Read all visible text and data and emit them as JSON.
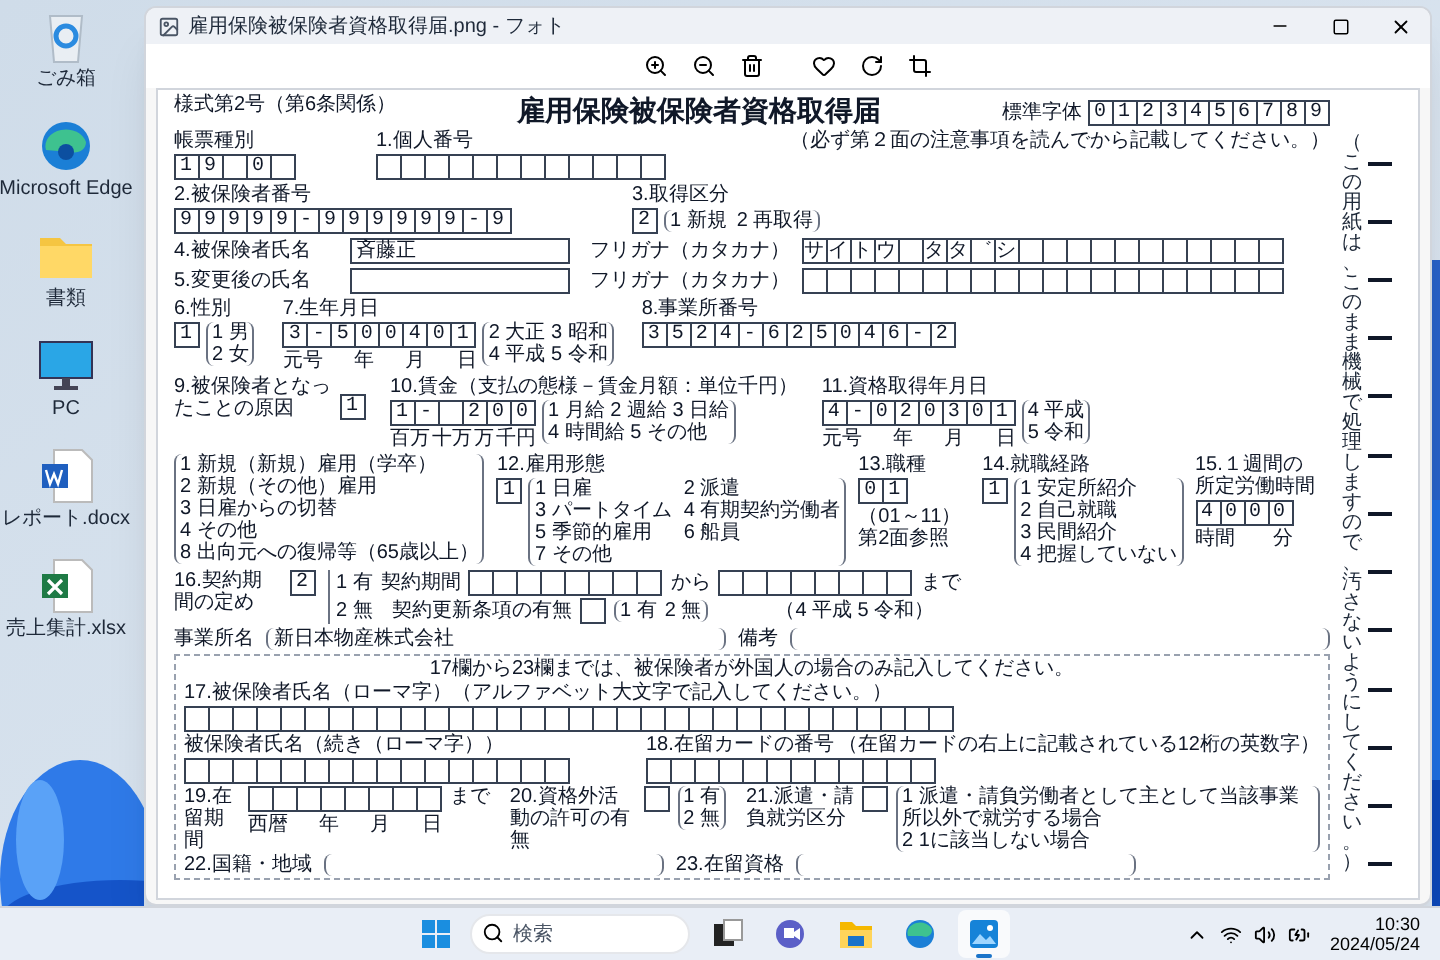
{
  "desktop_icons": [
    {
      "label": "ごみ箱",
      "kind": "recycle"
    },
    {
      "label": "Microsoft Edge",
      "kind": "edge"
    },
    {
      "label": "書類",
      "kind": "folder"
    },
    {
      "label": "PC",
      "kind": "pc"
    },
    {
      "label": "レポート.docx",
      "kind": "word"
    },
    {
      "label": "売上集計.xlsx",
      "kind": "excel"
    }
  ],
  "window": {
    "title": "雇用保険被保険者資格取得届.png - フォト"
  },
  "form": {
    "form_number": "様式第2号（第6条関係）",
    "title": "雇用保険被保険者資格取得届",
    "glyph_sample": {
      "label": "標準字体",
      "digits": "0123456789"
    },
    "note": "（必ず第２面の注意事項を読んでから記載してください。）",
    "slip_type": {
      "label": "帳票種別",
      "value": "19 0"
    },
    "individual_number": {
      "label": "1.個人番号"
    },
    "insured_number": {
      "label": "2.被保険者番号",
      "value": "99999-999999-9"
    },
    "acquisition_type": {
      "label": "3.取得区分",
      "value": "2",
      "options": [
        "1 新規",
        "2 再取得"
      ]
    },
    "name": {
      "label": "4.被保険者氏名",
      "value": "斉藤正",
      "kana_label": "フリガナ（カタカナ）",
      "kana": "サイトウ　タタ゛シ"
    },
    "new_name": {
      "label": "5.変更後の氏名",
      "kana_label": "フリガナ（カタカナ）"
    },
    "sex": {
      "label": "6.性別",
      "value": "1",
      "options": [
        "1 男",
        "2 女"
      ]
    },
    "birth_date": {
      "label": "7.生年月日",
      "value": "3-500401",
      "units": [
        "元号",
        "年",
        "月",
        "日"
      ],
      "options": [
        "2 大正 3 昭和",
        "4 平成 5 令和"
      ]
    },
    "office_number": {
      "label": "8.事業所番号",
      "value": "3524-625046-2"
    },
    "cause": {
      "label": "9.被保険者となったことの原因",
      "value": "1",
      "options": [
        "1 新規（新規）雇用（学卒）",
        "2 新規（その他）雇用",
        "3 日雇からの切替",
        "4 その他",
        "8 出向元への復帰等（65歳以上）"
      ]
    },
    "wage": {
      "label": "10.賃金（支払の態様－賃金月額：単位千円）",
      "value": "1- 200",
      "units": [
        "百万",
        "十万",
        "万",
        "千円"
      ],
      "options": [
        "1 月給 2 週給 3 日給",
        "4 時間給 5 その他"
      ]
    },
    "acquisition_date": {
      "label": "11.資格取得年月日",
      "value": "4-020301",
      "units": [
        "元号",
        "年",
        "月",
        "日"
      ],
      "options": [
        "4 平成",
        "5 令和"
      ]
    },
    "employment_type": {
      "label": "12.雇用形態",
      "value": "1",
      "options": [
        "1 日雇",
        "2 派遣",
        "3 パートタイム",
        "4 有期契約労働者",
        "5 季節的雇用",
        "6 船員",
        "7 その他"
      ]
    },
    "occupation": {
      "label": "13.職種",
      "value": "01",
      "note": "（01～11）第2面参照"
    },
    "job_route": {
      "label": "14.就職経路",
      "value": "1",
      "options": [
        "1 安定所紹介",
        "2 自己就職",
        "3 民間紹介",
        "4 把握していない"
      ]
    },
    "weekly_hours": {
      "label": "15.１週間の所定労働時間",
      "value": "4000",
      "units": [
        "時間",
        "分"
      ]
    },
    "contract_period": {
      "label": "16.契約期間の定め",
      "value": "2",
      "yes": "1 有",
      "no": "2 無",
      "period_label": "契約期間",
      "from": "から",
      "until": "まで",
      "era_note": "（4 平成 5 令和）",
      "renewal_label": "契約更新条項の有無",
      "renewal_options": [
        "1 有",
        "2 無"
      ]
    },
    "office_name": {
      "label": "事業所名",
      "value": "新日本物産株式会社"
    },
    "remarks": {
      "label": "備考"
    },
    "foreign": {
      "note": "17欄から23欄までは、被保険者が外国人の場合のみ記入してください。",
      "roman_name": "17.被保険者氏名（ローマ字）（アルファベット大文字で記入してください。）",
      "roman_name_cont": "被保険者氏名（続き（ローマ字））",
      "residence_card": {
        "label": "18.在留カードの番号",
        "note": "（在留カードの右上に記載されている12桁の英数字）"
      },
      "stay_period": {
        "label": "19.在留期間",
        "until": "まで",
        "units": [
          "西暦",
          "年",
          "月",
          "日"
        ]
      },
      "work_permit": {
        "label": "20.資格外活動の許可の有無",
        "options": [
          "1 有",
          "2 無"
        ]
      },
      "dispatch": {
        "label": "21.派遣・請負就労区分",
        "options": [
          "1 派遣・請負労働者として主として当該事業所以外で就労する場合",
          "2 1に該当しない場合"
        ]
      },
      "nationality": {
        "label": "22.国籍・地域"
      },
      "status": {
        "label": "23.在留資格"
      }
    },
    "side_note": "（この用紙は、このまま機械で処理しますので、汚さないようにしてください。）"
  },
  "taskbar": {
    "search": {
      "placeholder": "検索"
    },
    "apps": [
      {
        "kind": "taskview",
        "selected": false
      },
      {
        "kind": "chat",
        "selected": false
      },
      {
        "kind": "explorer",
        "selected": false
      },
      {
        "kind": "edge",
        "selected": false
      },
      {
        "kind": "photos",
        "selected": true
      }
    ],
    "time": "10:30",
    "date": "2024/05/24"
  }
}
